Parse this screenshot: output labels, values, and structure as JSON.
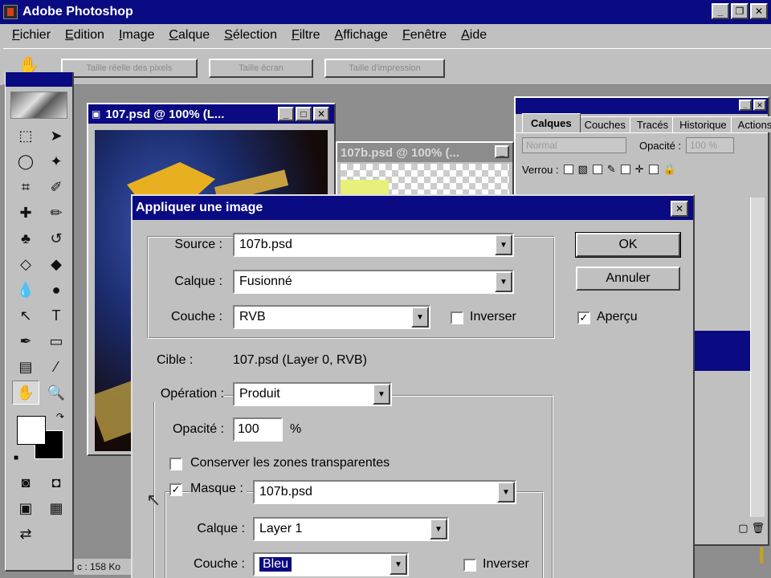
{
  "app": {
    "title": "Adobe Photoshop",
    "controls": [
      "_",
      "❐",
      "✕"
    ]
  },
  "menu": [
    "Fichier",
    "Edition",
    "Image",
    "Calque",
    "Sélection",
    "Filtre",
    "Affichage",
    "Fenêtre",
    "Aide"
  ],
  "options_bar": {
    "buttons": [
      "Taille réelle des pixels",
      "Taille écran",
      "Taille d'impression"
    ]
  },
  "documents": {
    "doc1_title": "107.psd @ 100% (L...",
    "doc2_title": "107b.psd @ 100% (..."
  },
  "layers_palette": {
    "tabs": [
      "Calques",
      "Couches",
      "Tracés",
      "Historique",
      "Actions"
    ],
    "blend_mode": "Normal",
    "opacity_label": "Opacité :",
    "opacity_value": "100 %",
    "lock_label": "Verrou :"
  },
  "status": {
    "doc_size": "c : 158 Ko"
  },
  "dialog": {
    "title": "Appliquer une image",
    "source_label": "Source :",
    "source_value": "107b.psd",
    "calque_label": "Calque :",
    "calque_value": "Fusionné",
    "couche_label": "Couche :",
    "couche_value": "RVB",
    "inverser_label": "Inverser",
    "inverser_checked": false,
    "cible_label": "Cible :",
    "cible_value": "107.psd (Layer 0, RVB)",
    "operation_label": "Opération :",
    "operation_value": "Produit",
    "opacite_label": "Opacité :",
    "opacite_value": "100",
    "opacite_unit": "%",
    "conserver_label": "Conserver les zones transparentes",
    "conserver_checked": false,
    "masque_label": "Masque :",
    "masque_checked": true,
    "masque_value": "107b.psd",
    "masque_calque_label": "Calque :",
    "masque_calque_value": "Layer 1",
    "masque_couche_label": "Couche :",
    "masque_couche_value": "Bleu",
    "masque_inverser_label": "Inverser",
    "ok_label": "OK",
    "annuler_label": "Annuler",
    "apercu_label": "Aperçu",
    "apercu_checked": true
  }
}
